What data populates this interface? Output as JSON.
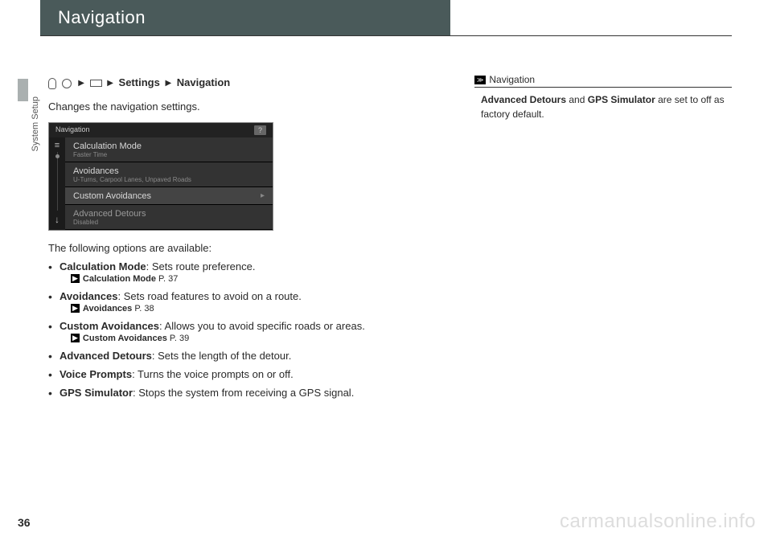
{
  "page": {
    "title": "Navigation",
    "section_tab": "System Setup",
    "number": "36",
    "watermark": "carmanualsonline.info"
  },
  "breadcrumb": {
    "settings": "Settings",
    "navigation": "Navigation"
  },
  "intro": "Changes the navigation settings.",
  "ui_screenshot": {
    "header": "Navigation",
    "help": "?",
    "rows": [
      {
        "title": "Calculation Mode",
        "sub": "Faster Time"
      },
      {
        "title": "Avoidances",
        "sub": "U-Turns, Carpool Lanes, Unpaved Roads"
      },
      {
        "title": "Custom Avoidances",
        "sub": ""
      },
      {
        "title": "Advanced Detours",
        "sub": "Disabled"
      }
    ]
  },
  "following": "The following options are available:",
  "options": [
    {
      "title": "Calculation Mode",
      "desc": ": Sets route preference.",
      "ref": "Calculation Mode",
      "page": "P. 37"
    },
    {
      "title": "Avoidances",
      "desc": ": Sets road features to avoid on a route.",
      "ref": "Avoidances",
      "page": "P. 38"
    },
    {
      "title": "Custom Avoidances",
      "desc": ": Allows you to avoid specific roads or areas.",
      "ref": "Custom Avoidances",
      "page": "P. 39"
    },
    {
      "title": "Advanced Detours",
      "desc": ": Sets the length of the detour."
    },
    {
      "title": "Voice Prompts",
      "desc": ": Turns the voice prompts on or off."
    },
    {
      "title": "GPS Simulator",
      "desc": ": Stops the system from receiving a GPS signal."
    }
  ],
  "sidebar": {
    "heading": "Navigation",
    "note_bold1": "Advanced Detours",
    "note_mid": " and ",
    "note_bold2": "GPS Simulator",
    "note_rest": " are set to off as factory default."
  }
}
